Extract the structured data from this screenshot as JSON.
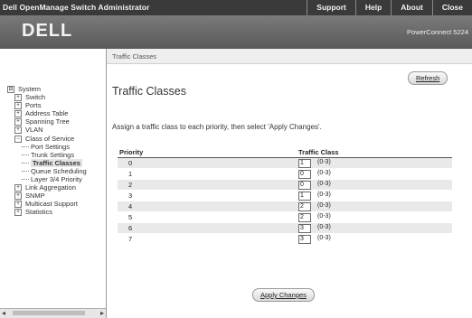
{
  "window": {
    "app_title": "Dell OpenManage Switch Administrator"
  },
  "toplinks": [
    {
      "label": "Support"
    },
    {
      "label": "Help"
    },
    {
      "label": "About"
    },
    {
      "label": "Close"
    }
  ],
  "banner": {
    "logo": "DELL",
    "product": "PowerConnect 5224"
  },
  "tree": {
    "nodes": [
      {
        "label": "System",
        "expander": "⊟",
        "indent": 0
      },
      {
        "label": "Switch",
        "expander": "+",
        "indent": 1
      },
      {
        "label": "Ports",
        "expander": "+",
        "indent": 1
      },
      {
        "label": "Address Table",
        "expander": "+",
        "indent": 1
      },
      {
        "label": "Spanning Tree",
        "expander": "+",
        "indent": 1
      },
      {
        "label": "VLAN",
        "expander": "+",
        "indent": 1
      },
      {
        "label": "Class of Service",
        "expander": "−",
        "indent": 1
      },
      {
        "label": "Port Settings",
        "expander": "",
        "indent": 2
      },
      {
        "label": "Trunk Settings",
        "expander": "",
        "indent": 2
      },
      {
        "label": "Traffic Classes",
        "expander": "",
        "indent": 2
      },
      {
        "label": "Queue Scheduling",
        "expander": "",
        "indent": 2
      },
      {
        "label": "Layer 3/4 Priority",
        "expander": "",
        "indent": 2
      },
      {
        "label": "Link Aggregation",
        "expander": "+",
        "indent": 1
      },
      {
        "label": "SNMP",
        "expander": "+",
        "indent": 1
      },
      {
        "label": "Multicast Support",
        "expander": "+",
        "indent": 1
      },
      {
        "label": "Statistics",
        "expander": "+",
        "indent": 1
      }
    ]
  },
  "breadcrumb": "Traffic Classes",
  "page": {
    "title": "Traffic Classes",
    "refresh_label": "Refresh",
    "instructions": "Assign a traffic class to each priority, then select 'Apply Changes'.",
    "apply_label": "Apply Changes"
  },
  "table": {
    "headers": {
      "priority": "Priority",
      "traffic_class": "Traffic Class"
    },
    "range": "(0-3)",
    "rows": [
      {
        "priority": "0",
        "tc": "1"
      },
      {
        "priority": "1",
        "tc": "0"
      },
      {
        "priority": "2",
        "tc": "0"
      },
      {
        "priority": "3",
        "tc": "1"
      },
      {
        "priority": "4",
        "tc": "2"
      },
      {
        "priority": "5",
        "tc": "2"
      },
      {
        "priority": "6",
        "tc": "3"
      },
      {
        "priority": "7",
        "tc": "3"
      }
    ]
  },
  "colors": {
    "titlebar": "#3a3a3a",
    "banner": "#6a6a6a",
    "row_shade": "#e9e9e9"
  }
}
